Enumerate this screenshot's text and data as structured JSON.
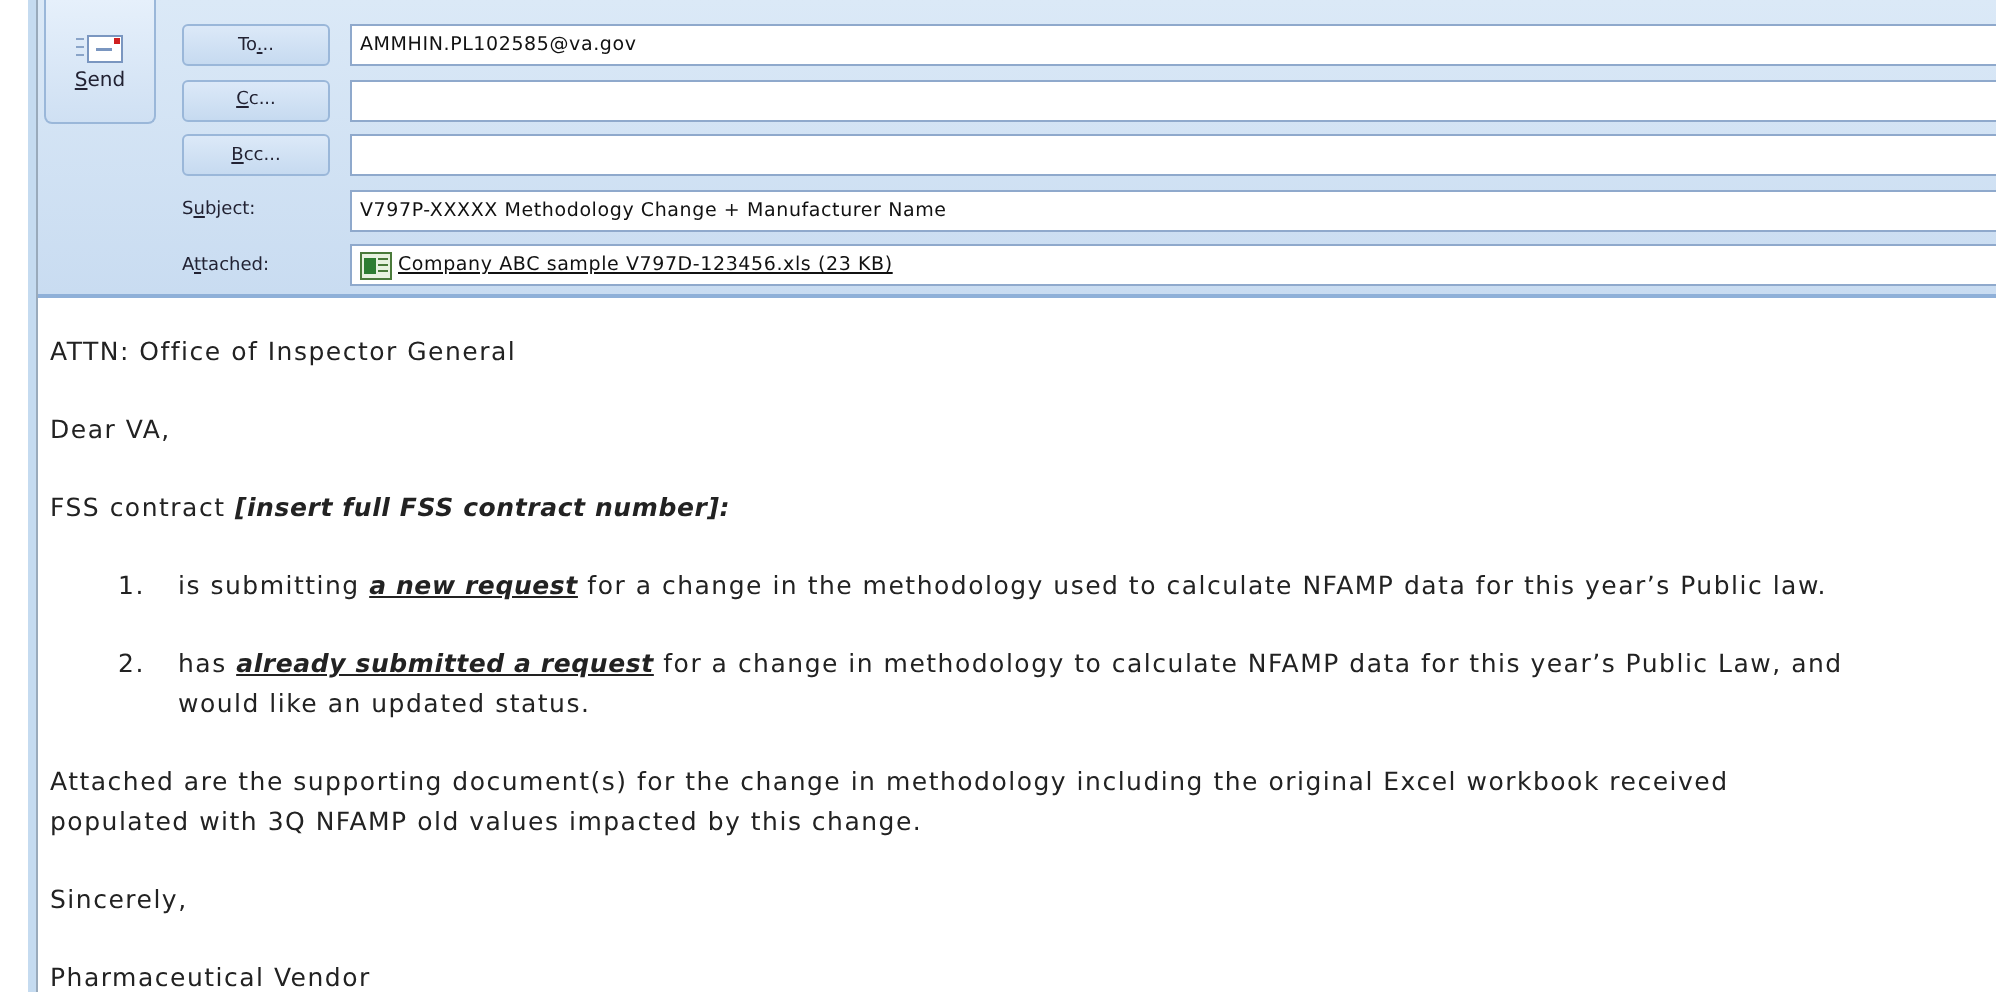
{
  "send_button": {
    "label": "Send"
  },
  "address_rows": [
    {
      "button": "To...",
      "value": "AMMHIN.PL102585@va.gov"
    },
    {
      "button": "Cc...",
      "value": ""
    },
    {
      "button": "Bcc...",
      "value": ""
    }
  ],
  "subject": {
    "label": "Subject:",
    "value": "V797P-XXXXX Methodology Change + Manufacturer Name"
  },
  "attached": {
    "label": "Attached:",
    "file": "Company ABC sample V797D-123456.xls (23 KB)"
  },
  "body": [
    {
      "kind": "paragraph",
      "parts": [
        {
          "text": "ATTN: Office of Inspector General",
          "kind": "plain"
        }
      ]
    },
    {
      "kind": "paragraph",
      "parts": [
        {
          "text": "Dear VA,",
          "kind": "plain"
        }
      ]
    },
    {
      "kind": "paragraph",
      "parts": [
        {
          "text": "FSS contract ",
          "kind": "plain"
        },
        {
          "text": "[insert full FSS contract number]:",
          "kind": "emphasis"
        }
      ]
    },
    {
      "kind": "list_item",
      "number": "1.",
      "parts": [
        {
          "text": "is submitting ",
          "kind": "plain"
        },
        {
          "text": "a new request",
          "kind": "underlined"
        },
        {
          "text": " for a change in the methodology used to calculate NFAMP data for this year’s Public law.",
          "kind": "plain"
        }
      ]
    },
    {
      "kind": "list_item",
      "number": "2.",
      "parts": [
        {
          "text": "has ",
          "kind": "plain"
        },
        {
          "text": "already submitted a request",
          "kind": "underlined"
        },
        {
          "text": " for a change in methodology to calculate NFAMP data for this year’s Public Law, and",
          "kind": "plain"
        },
        {
          "text": "would like an updated status.",
          "kind": "newline"
        }
      ]
    },
    {
      "kind": "paragraph",
      "parts": [
        {
          "text": "Attached are the supporting document(s) for the change in methodology including the original Excel workbook received",
          "kind": "plain"
        },
        {
          "text": "populated with 3Q NFAMP old values impacted by this change.",
          "kind": "newline"
        }
      ]
    },
    {
      "kind": "paragraph",
      "parts": [
        {
          "text": "Sincerely,",
          "kind": "plain"
        }
      ]
    },
    {
      "kind": "paragraph",
      "parts": [
        {
          "text": "Pharmaceutical Vendor",
          "kind": "plain"
        }
      ]
    }
  ]
}
